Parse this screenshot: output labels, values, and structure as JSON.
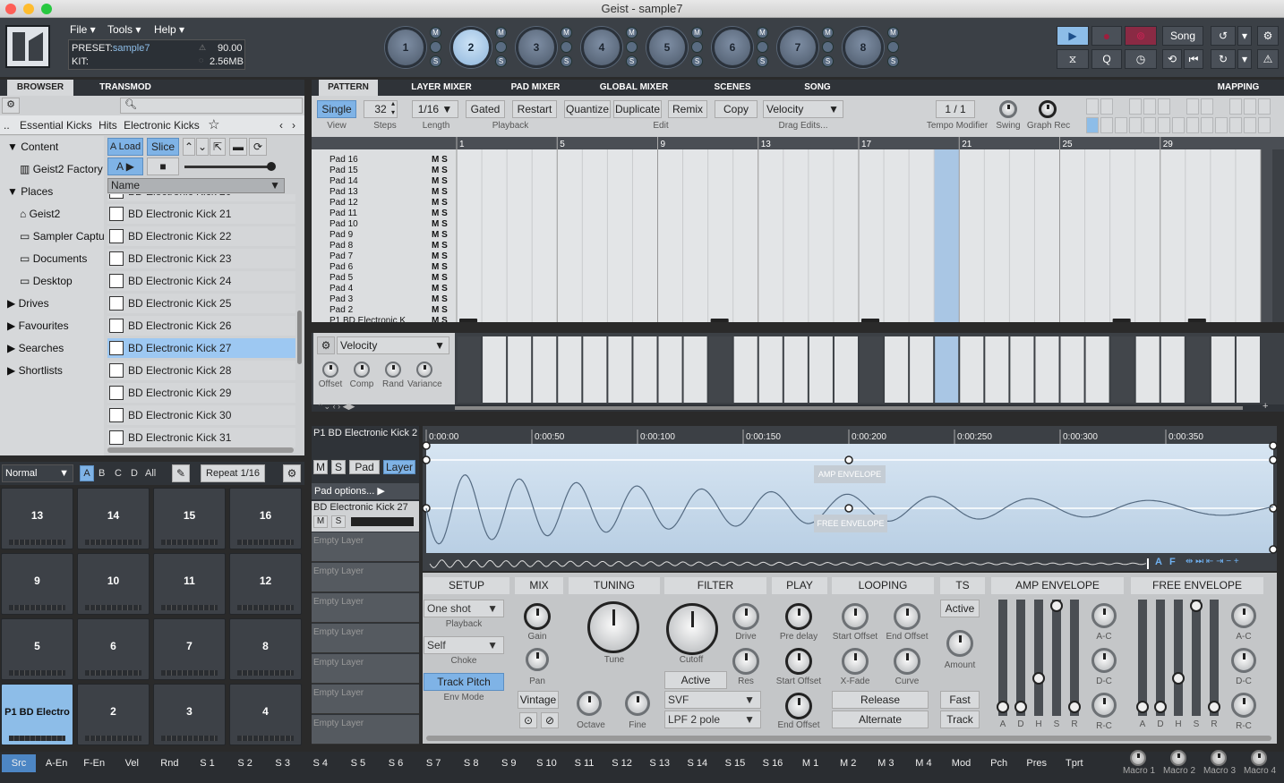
{
  "window": {
    "title": "Geist - sample7"
  },
  "menu": {
    "file": "File",
    "tools": "Tools",
    "help": "Help"
  },
  "preset": {
    "label": "PRESET:",
    "name": "sample7",
    "kit": "KIT:",
    "tempo": "90.00",
    "memory": "2.56MB"
  },
  "channels": [
    {
      "num": "1"
    },
    {
      "num": "2"
    },
    {
      "num": "3"
    },
    {
      "num": "4"
    },
    {
      "num": "5"
    },
    {
      "num": "6"
    },
    {
      "num": "7"
    },
    {
      "num": "8"
    }
  ],
  "channel_ms": {
    "m": "M",
    "s": "S"
  },
  "transport": {
    "song": "Song",
    "q": "Q"
  },
  "left_tabs": {
    "browser": "BROWSER",
    "transmod": "TRANSMOD"
  },
  "main_tabs": [
    "PATTERN",
    "LAYER MIXER",
    "PAD MIXER",
    "GLOBAL MIXER",
    "SCENES",
    "SONG",
    "MAPPING"
  ],
  "browser": {
    "breadcrumb": [
      "..",
      "Essential Kicks",
      "Hits",
      "Electronic Kicks"
    ],
    "sidebar": {
      "content": "Content",
      "geist2_factory": "Geist2 Factory",
      "places": "Places",
      "geist2": "Geist2",
      "sampler_capture": "Sampler Capture",
      "documents": "Documents",
      "desktop": "Desktop",
      "drives": "Drives",
      "favourites": "Favourites",
      "searches": "Searches",
      "shortlists": "Shortlists"
    },
    "a_load": "A Load",
    "slice": "Slice",
    "a": "A",
    "name_col": "Name",
    "files": [
      "BD Electronic Kick 20",
      "BD Electronic Kick 21",
      "BD Electronic Kick 22",
      "BD Electronic Kick 23",
      "BD Electronic Kick 24",
      "BD Electronic Kick 25",
      "BD Electronic Kick 26",
      "BD Electronic Kick 27",
      "BD Electronic Kick 28",
      "BD Electronic Kick 29",
      "BD Electronic Kick 30",
      "BD Electronic Kick 31"
    ]
  },
  "pad_controls": {
    "mode": "Normal",
    "banks": [
      "A",
      "B",
      "C",
      "D",
      "All"
    ],
    "repeat": "Repeat",
    "repeat_val": "1/16"
  },
  "pads": [
    [
      "13",
      "14",
      "15",
      "16"
    ],
    [
      "9",
      "10",
      "11",
      "12"
    ],
    [
      "5",
      "6",
      "7",
      "8"
    ],
    [
      "P1 BD Electro",
      "2",
      "3",
      "4"
    ]
  ],
  "pattern_toolbar": {
    "single": "Single",
    "steps": "32",
    "length": "1/16",
    "gated": "Gated",
    "restart": "Restart",
    "quantize": "Quantize",
    "duplicate": "Duplicate",
    "remix": "Remix",
    "copy": "Copy",
    "velocity": "Velocity",
    "view_lbl": "View",
    "steps_lbl": "Steps",
    "length_lbl": "Length",
    "playback_lbl": "Playback",
    "edit_lbl": "Edit",
    "drag_lbl": "Drag Edits...",
    "tempo_mod": "1 / 1",
    "tempo_mod_lbl": "Tempo Modifier",
    "swing_lbl": "Swing",
    "graph_rec_lbl": "Graph Rec"
  },
  "grid": {
    "markers": [
      "1",
      "5",
      "9",
      "13",
      "17",
      "21",
      "25",
      "29"
    ],
    "rows": [
      "Pad 16",
      "Pad 15",
      "Pad 14",
      "Pad 13",
      "Pad 12",
      "Pad 11",
      "Pad 10",
      "Pad 9",
      "Pad 8",
      "Pad 7",
      "Pad 6",
      "Pad 5",
      "Pad 4",
      "Pad 3",
      "Pad 2",
      "P1 BD Electronic K"
    ],
    "ms": "M  S",
    "hits_steps": [
      1,
      11,
      17,
      27,
      30
    ]
  },
  "velocity_lane": {
    "label": "Velocity",
    "knobs": [
      "Offset",
      "Comp",
      "Rand",
      "Variance"
    ],
    "hits_steps": [
      1,
      11,
      17,
      27,
      30
    ]
  },
  "layer": {
    "pad_name": "P1 BD Electronic Kick 2:",
    "m": "M",
    "s": "S",
    "pad": "Pad",
    "layer": "Layer",
    "pad_options": "Pad options...",
    "sample": "BD Electronic Kick 27",
    "empty": "Empty Layer",
    "empty_count": 7
  },
  "waveform": {
    "times": [
      "0:00:00",
      "0:00:50",
      "0:00:100",
      "0:00:150",
      "0:00:200",
      "0:00:250",
      "0:00:300",
      "0:00:350"
    ],
    "amp_env": "AMP ENVELOPE",
    "free_env": "FREE ENVELOPE",
    "a": "A",
    "f": "F"
  },
  "sections": {
    "setup": {
      "title": "SETUP",
      "playback": "One shot",
      "playback_lbl": "Playback",
      "choke": "Self",
      "choke_lbl": "Choke",
      "env_mode": "Track Pitch",
      "env_mode_lbl": "Env Mode"
    },
    "mix": {
      "title": "MIX",
      "gain": "Gain",
      "pan": "Pan",
      "vintage": "Vintage"
    },
    "tuning": {
      "title": "TUNING",
      "tune": "Tune",
      "octave": "Octave",
      "fine": "Fine"
    },
    "filter": {
      "title": "FILTER",
      "cutoff": "Cutoff",
      "drive": "Drive",
      "res": "Res",
      "active": "Active",
      "svf": "SVF",
      "lpf": "LPF 2 pole"
    },
    "play": {
      "title": "PLAY",
      "pre_delay": "Pre delay",
      "start_offset": "Start Offset",
      "end_offset": "End Offset"
    },
    "looping": {
      "title": "LOOPING",
      "start_offset": "Start Offset",
      "end_offset": "End Offset",
      "xfade": "X-Fade",
      "curve": "Curve",
      "release": "Release",
      "alternate": "Alternate"
    },
    "ts": {
      "title": "TS",
      "active": "Active",
      "amount": "Amount",
      "fast": "Fast",
      "track": "Track"
    },
    "amp_env": {
      "title": "AMP ENVELOPE",
      "sliders": [
        "A",
        "D",
        "H",
        "S",
        "R"
      ],
      "knobs": [
        "A-C",
        "D-C",
        "R-C"
      ],
      "levels": [
        0.03,
        0.03,
        0.3,
        1.0,
        0.03
      ]
    },
    "free_env": {
      "title": "FREE ENVELOPE",
      "sliders": [
        "A",
        "D",
        "H",
        "S",
        "R"
      ],
      "knobs": [
        "A-C",
        "D-C",
        "R-C"
      ],
      "levels": [
        0.03,
        0.03,
        0.3,
        1.0,
        0.03
      ]
    }
  },
  "bottom_tabs": [
    "Src",
    "A-En",
    "F-En",
    "Vel",
    "Rnd",
    "S 1",
    "S 2",
    "S 3",
    "S 4",
    "S 5",
    "S 6",
    "S 7",
    "S 8",
    "S 9",
    "S 10",
    "S 11",
    "S 12",
    "S 13",
    "S 14",
    "S 15",
    "S 16",
    "M 1",
    "M 2",
    "M 3",
    "M 4",
    "Mod",
    "Pch",
    "Pres",
    "Tprt"
  ],
  "macros": [
    "Macro 1",
    "Macro 2",
    "Macro 3",
    "Macro 4"
  ],
  "colors": {
    "accent": "#8dbde8",
    "bg": "#2a2a2a",
    "panel": "#c9cbcd"
  }
}
